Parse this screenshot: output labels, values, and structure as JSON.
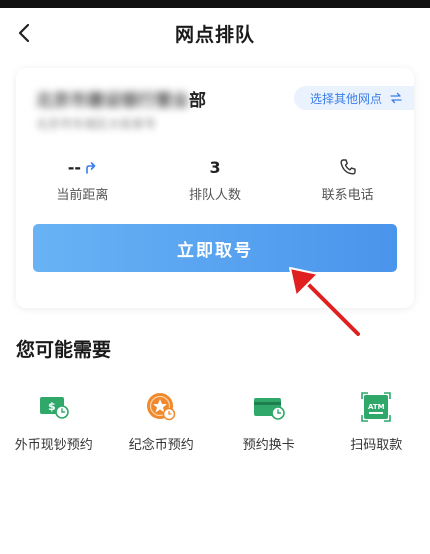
{
  "header": {
    "title": "网点排队"
  },
  "branch": {
    "name_prefix": "北京市建设银行营业",
    "name_suffix": "部",
    "address": "北京市东城区大街某号",
    "switch_label": "选择其他网点"
  },
  "stats": [
    {
      "value": "--",
      "label": "当前距离",
      "icon": "navigation-arrow-icon"
    },
    {
      "value": "3",
      "label": "排队人数"
    },
    {
      "label": "联系电话",
      "icon": "phone-icon"
    }
  ],
  "primary_action": {
    "label": "立即取号"
  },
  "recommend": {
    "title": "您可能需要",
    "items": [
      {
        "label": "外币现钞预约",
        "icon": "foreign-cash-icon",
        "color": "#2fa86a"
      },
      {
        "label": "纪念币预约",
        "icon": "commemorative-coin-icon",
        "color": "#f0892b"
      },
      {
        "label": "预约换卡",
        "icon": "card-exchange-icon",
        "color": "#2fa86a"
      },
      {
        "label": "扫码取款",
        "icon": "atm-scan-icon",
        "color": "#2fa86a"
      }
    ]
  },
  "colors": {
    "accent": "#3a7ee8",
    "button_start": "#68b2f5",
    "button_end": "#4a95ec",
    "annotation_arrow": "#e02020"
  }
}
